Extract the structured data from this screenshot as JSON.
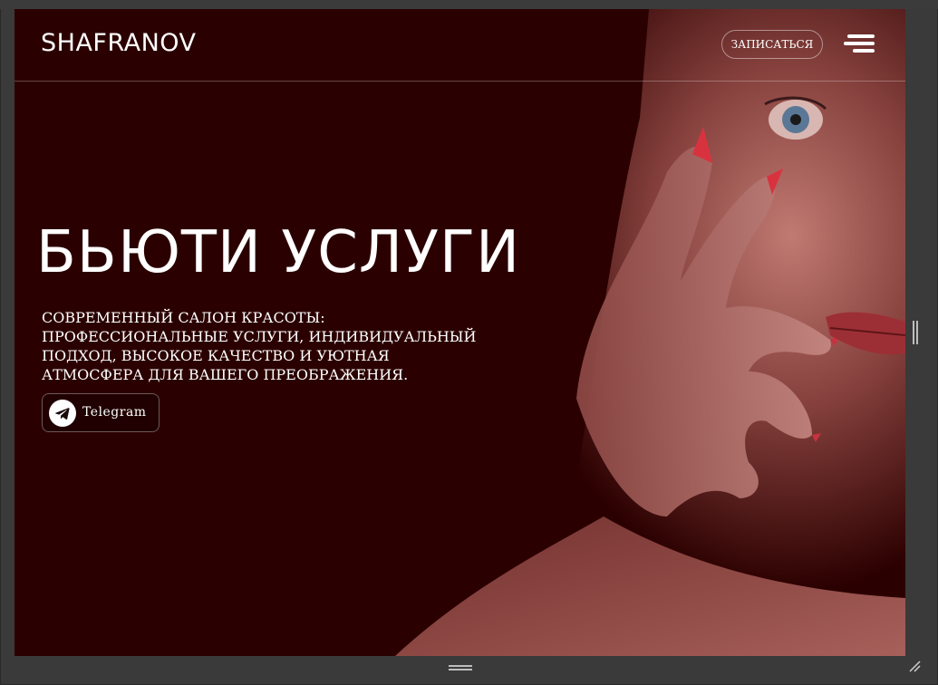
{
  "header": {
    "logo": "SHAFRANOV",
    "cta_label": "ЗАПИСАТЬСЯ"
  },
  "hero": {
    "title": "БЬЮТИ  УСЛУГИ",
    "description": "СОВРЕМЕННЫЙ САЛОН КРАСОТЫ: ПРОФЕССИОНАЛЬНЫЕ УСЛУГИ, ИНДИВИДУАЛЬНЫЙ ПОДХОД, ВЫСОКОЕ КАЧЕСТВО И УЮТНАЯ АТМОСФЕРА ДЛЯ ВАШЕГО ПРЕОБРАЖЕНИЯ.",
    "telegram_label": "Telegram",
    "telegram_icon": "telegram-icon"
  },
  "icons": {
    "menu": "hamburger-menu-icon",
    "resize_corner": "resize-corner-icon"
  },
  "colors": {
    "background": "#2b0000",
    "text": "#ffffff",
    "frame": "#3a3a3a"
  }
}
